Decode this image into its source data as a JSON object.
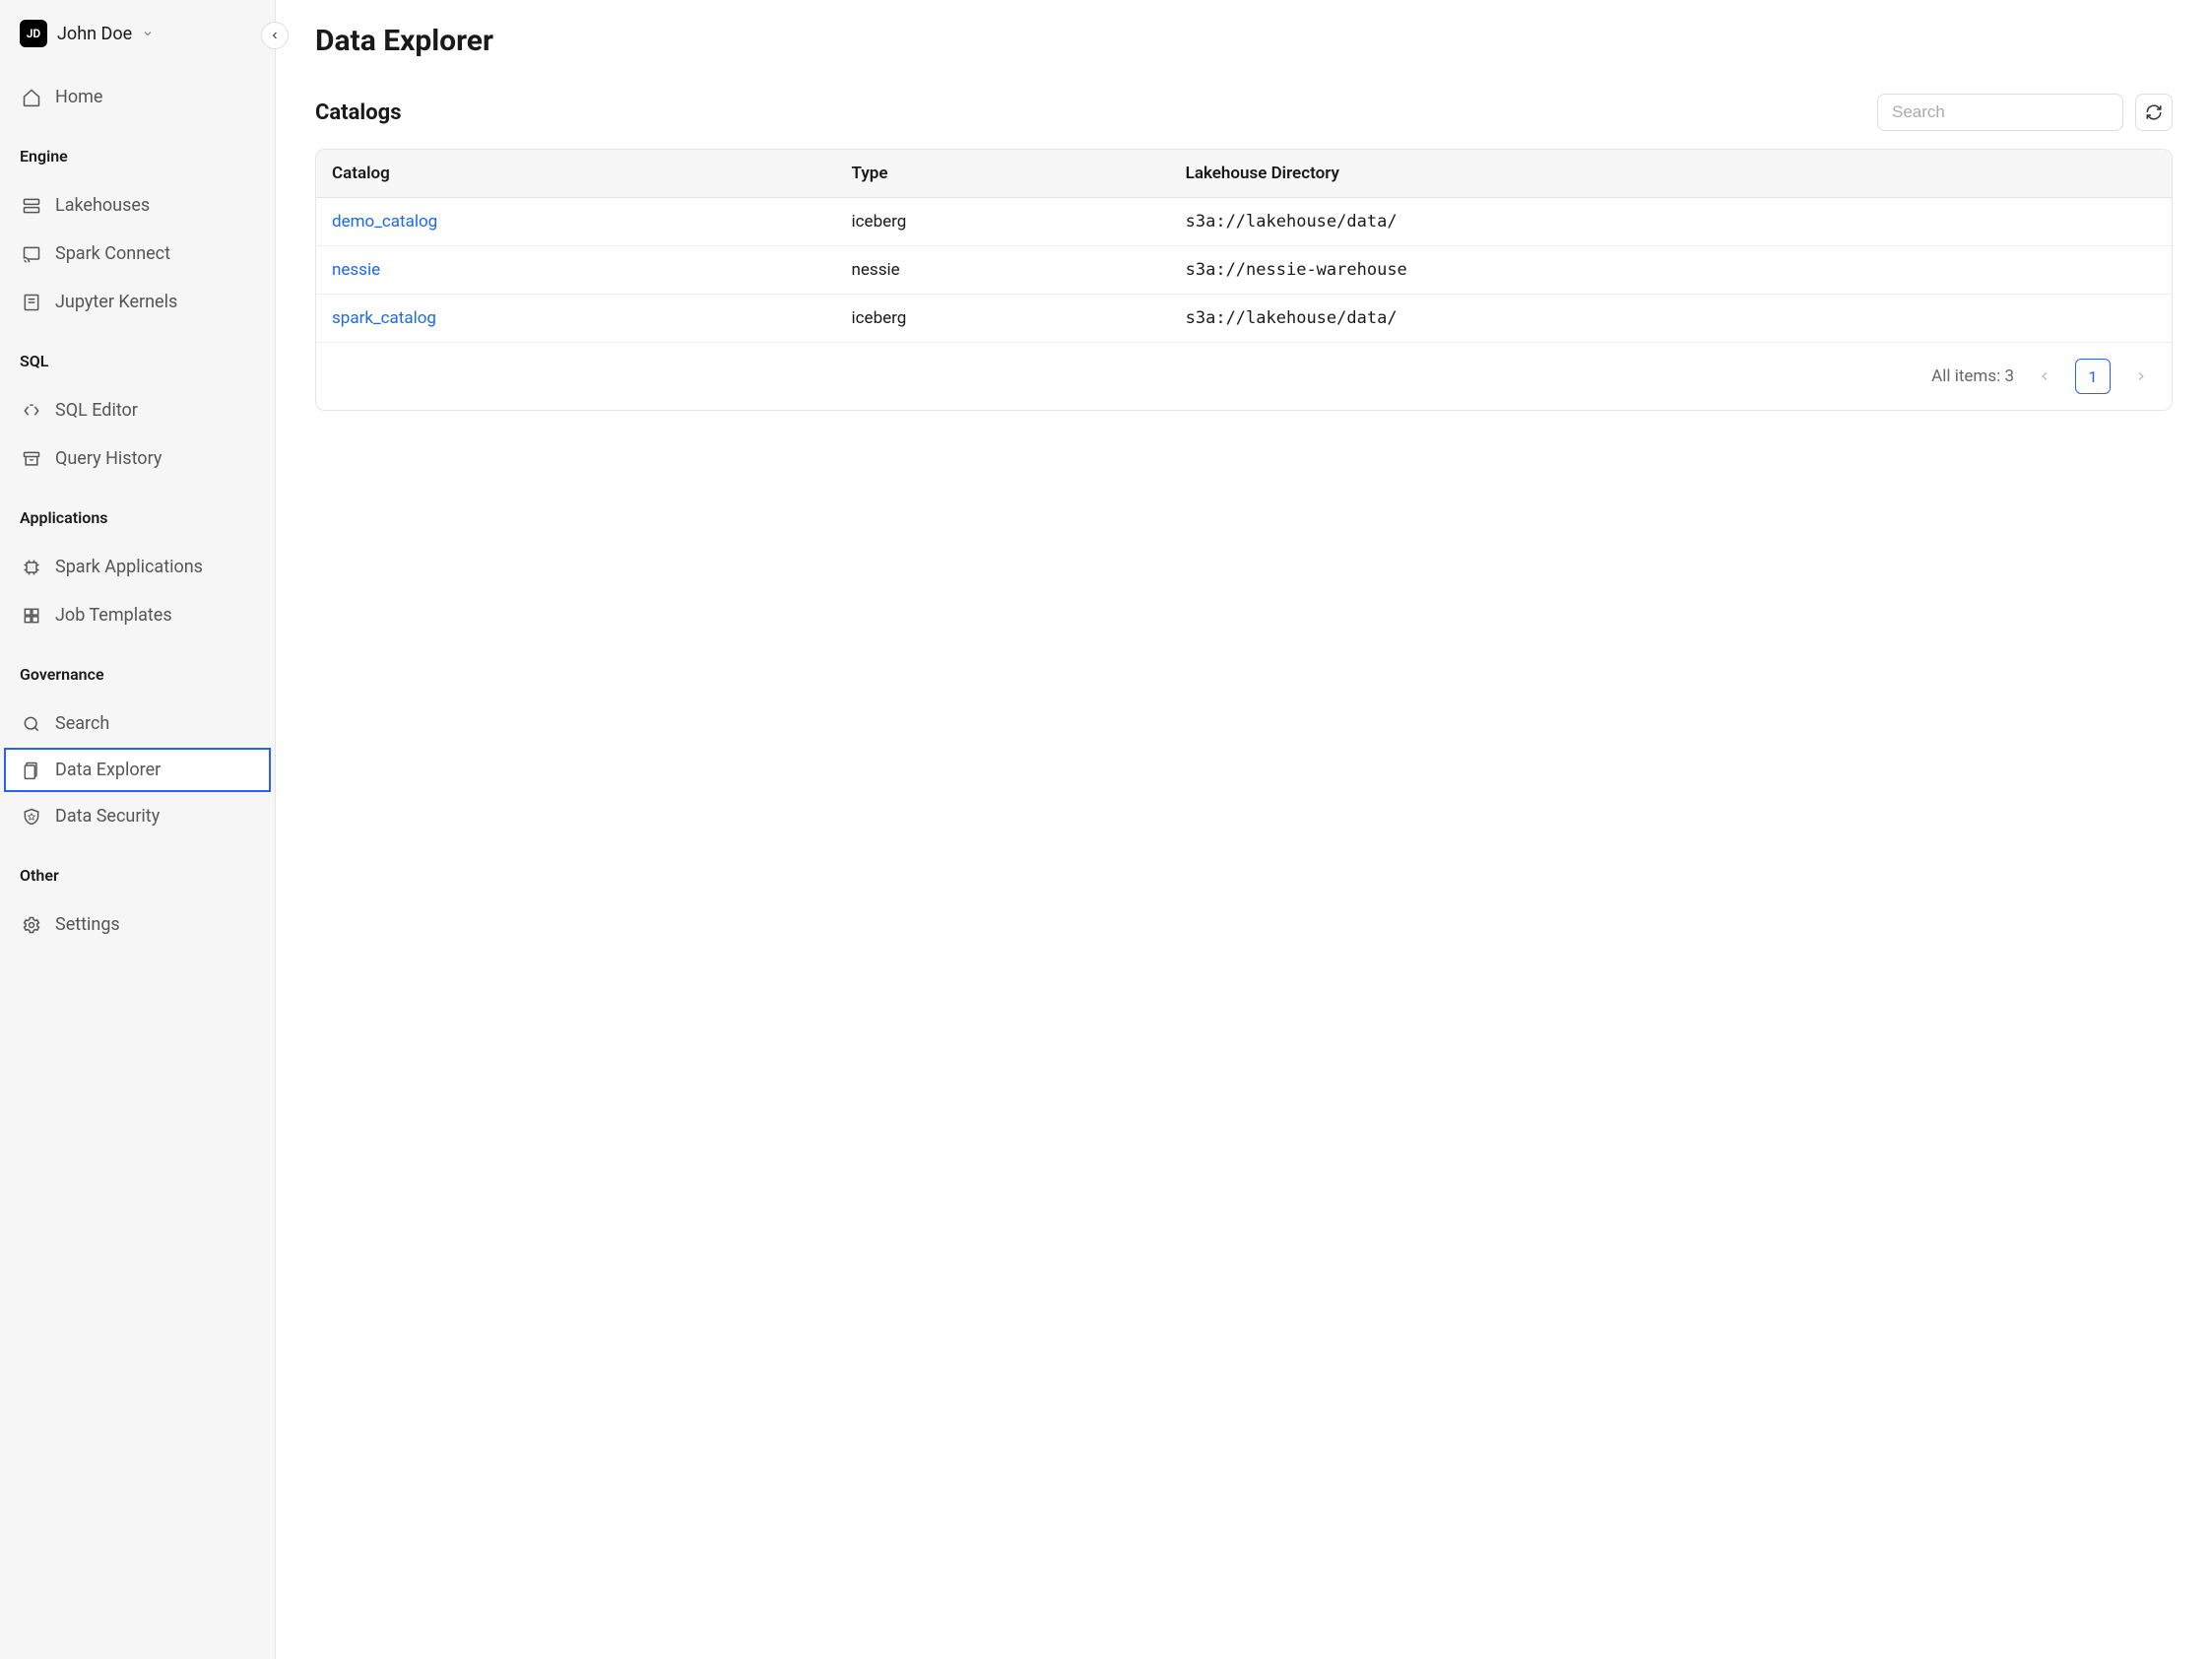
{
  "user": {
    "initials": "JD",
    "name": "John Doe"
  },
  "sidebar": {
    "home": "Home",
    "sections": [
      {
        "title": "Engine",
        "items": [
          {
            "label": "Lakehouses",
            "icon": "server"
          },
          {
            "label": "Spark Connect",
            "icon": "cast"
          },
          {
            "label": "Jupyter Kernels",
            "icon": "notebook"
          }
        ]
      },
      {
        "title": "SQL",
        "items": [
          {
            "label": "SQL Editor",
            "icon": "code"
          },
          {
            "label": "Query History",
            "icon": "archive"
          }
        ]
      },
      {
        "title": "Applications",
        "items": [
          {
            "label": "Spark Applications",
            "icon": "chip"
          },
          {
            "label": "Job Templates",
            "icon": "grid"
          }
        ]
      },
      {
        "title": "Governance",
        "items": [
          {
            "label": "Search",
            "icon": "search"
          },
          {
            "label": "Data Explorer",
            "icon": "data",
            "active": true
          },
          {
            "label": "Data Security",
            "icon": "shield"
          }
        ]
      },
      {
        "title": "Other",
        "items": [
          {
            "label": "Settings",
            "icon": "gear"
          }
        ]
      }
    ]
  },
  "page": {
    "title": "Data Explorer",
    "catalogs_label": "Catalogs",
    "search_placeholder": "Search",
    "columns": {
      "catalog": "Catalog",
      "type": "Type",
      "directory": "Lakehouse Directory"
    },
    "rows": [
      {
        "catalog": "demo_catalog",
        "type": "iceberg",
        "directory": "s3a://lakehouse/data/"
      },
      {
        "catalog": "nessie",
        "type": "nessie",
        "directory": "s3a://nessie-warehouse"
      },
      {
        "catalog": "spark_catalog",
        "type": "iceberg",
        "directory": "s3a://lakehouse/data/"
      }
    ],
    "footer": {
      "all_items": "All items: 3",
      "page": "1"
    }
  }
}
